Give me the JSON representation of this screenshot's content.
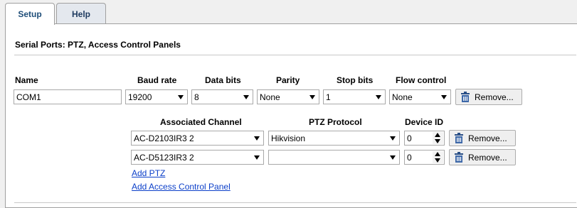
{
  "tabs": [
    {
      "label": "Setup"
    },
    {
      "label": "Help"
    }
  ],
  "section_title": "Serial Ports: PTZ, Access Control Panels",
  "port_headers": {
    "name": "Name",
    "baud_rate": "Baud rate",
    "data_bits": "Data bits",
    "parity": "Parity",
    "stop_bits": "Stop bits",
    "flow_control": "Flow control"
  },
  "port": {
    "name": "COM1",
    "baud_rate": "19200",
    "data_bits": "8",
    "parity": "None",
    "stop_bits": "1",
    "flow_control": "None",
    "remove_label": "Remove..."
  },
  "channel_headers": {
    "associated_channel": "Associated Channel",
    "ptz_protocol": "PTZ Protocol",
    "device_id": "Device ID"
  },
  "channels": [
    {
      "channel": "AC-D2103IR3 2",
      "protocol": "Hikvision",
      "device_id": "0",
      "remove_label": "Remove..."
    },
    {
      "channel": "AC-D5123IR3 2",
      "protocol": "",
      "device_id": "0",
      "remove_label": "Remove..."
    }
  ],
  "links": {
    "add_ptz": "Add PTZ",
    "add_access_control_panel": "Add Access Control Panel"
  }
}
